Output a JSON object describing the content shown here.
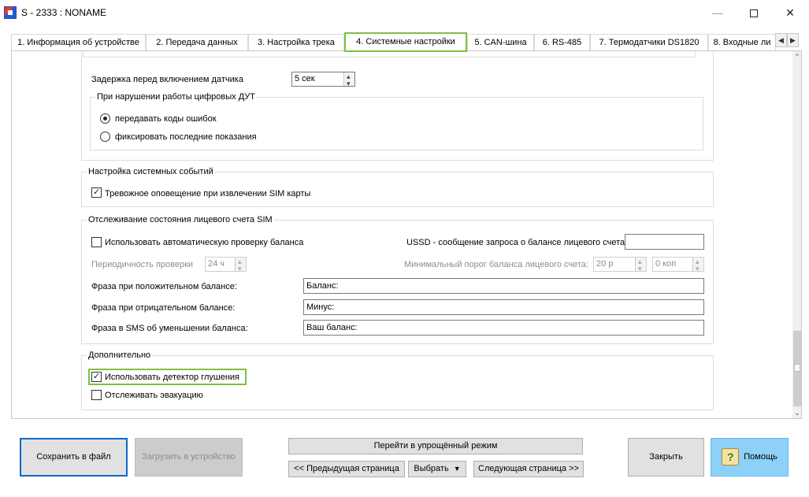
{
  "window": {
    "title": "S - 2333 : NONAME"
  },
  "tabs": [
    {
      "label": "1. Информация об устройстве",
      "active": false
    },
    {
      "label": "2. Передача данных",
      "active": false
    },
    {
      "label": "3. Настройка трека",
      "active": false
    },
    {
      "label": "4. Системные настройки",
      "active": true
    },
    {
      "label": "5. CAN-шина",
      "active": false
    },
    {
      "label": "6. RS-485",
      "active": false
    },
    {
      "label": "7. Термодатчики DS1820",
      "active": false
    },
    {
      "label": "8. Входные ли",
      "active": false
    }
  ],
  "sensor_delay": {
    "label": "Задержка перед включением датчика",
    "value": "5 сек"
  },
  "dut_group": {
    "title": "При нарушении работы цифровых ДУТ",
    "options": [
      {
        "label": "передавать коды ошибок",
        "selected": true
      },
      {
        "label": "фиксировать последние показания",
        "selected": false
      }
    ]
  },
  "system_events": {
    "title": "Настройка системных событий",
    "sim_alert": {
      "label": "Тревожное оповещение при извлечении SIM карты",
      "checked": true
    }
  },
  "balance": {
    "title": "Отслеживание состояния лицевого счета SIM",
    "auto_check": {
      "label": "Использовать автоматическую проверку баланса",
      "checked": false
    },
    "ussd_label": "USSD - сообщение запроса о балансе лицевого счета",
    "ussd_value": "",
    "period_label": "Периодичность проверки",
    "period_value": "24 ч",
    "threshold_label": "Минимальный порог баланса лицевого счета:",
    "threshold_rub": "20 р",
    "threshold_kop": "0 коп",
    "positive_label": "Фраза при положительном балансе:",
    "positive_value": "Баланс:",
    "negative_label": "Фраза при отрицательном балансе:",
    "negative_value": "Минус:",
    "decrease_label": "Фраза в SMS об уменьшении баланса:",
    "decrease_value": "Ваш баланс:"
  },
  "additional": {
    "title": "Дополнительно",
    "jamming": {
      "label": "Использовать детектор глушения",
      "checked": true
    },
    "evacuation": {
      "label": "Отслеживать эвакуацию",
      "checked": false
    }
  },
  "footer": {
    "save_file": "Сохранить в файл",
    "load_device": "Загрузить в устройство",
    "simple_mode": "Перейти в упрощённый режим",
    "prev_page": "<<  Предыдущая страница",
    "choose": "Выбрать",
    "next_page": "Следующая страница  >>",
    "close": "Закрыть",
    "help": "Помощь"
  },
  "colors": {
    "highlight": "#7cc242",
    "help_button": "#8dd0f8",
    "focus_border": "#0a6ac8"
  }
}
